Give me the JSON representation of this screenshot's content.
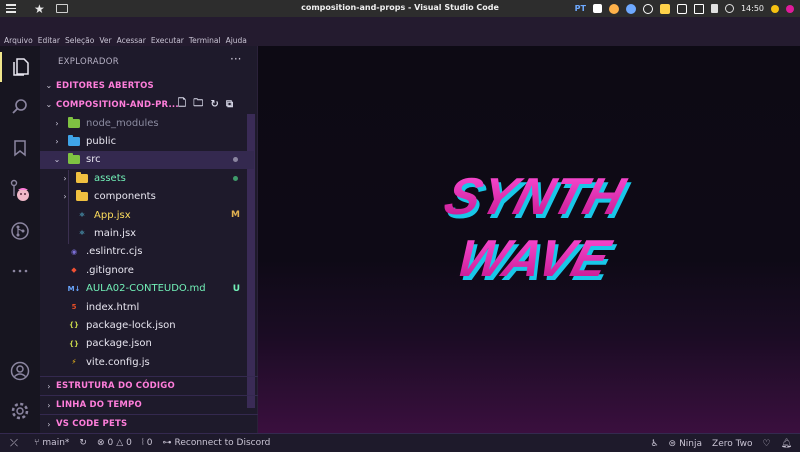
{
  "os": {
    "window_title": "composition-and-props - Visual Studio Code",
    "lang": "PT",
    "clock": "14:50",
    "tray_colors": [
      "#ffffff",
      "#ffb24a",
      "#6ea9ff",
      "#ffffff",
      "#ffd34a",
      "#ffffff"
    ]
  },
  "menu": [
    "Arquivo",
    "Editar",
    "Seleção",
    "Ver",
    "Acessar",
    "Executar",
    "Terminal",
    "Ajuda"
  ],
  "sidebar": {
    "title": "EXPLORADOR",
    "more": "···",
    "sections": {
      "open_editors": "EDITORES ABERTOS",
      "project": "COMPOSITION-AND-PR...",
      "outline": "ESTRUTURA DO CÓDIGO",
      "timeline": "LINHA DO TEMPO",
      "pets": "VS CODE PETS"
    },
    "files": [
      {
        "name": "node_modules",
        "kind": "folder",
        "color": "#8b8ba0",
        "icon_color": "#7fc242"
      },
      {
        "name": "public",
        "kind": "folder",
        "color": "#e8e6f0",
        "icon_color": "#3fa4e8"
      },
      {
        "name": "src",
        "kind": "folder-open",
        "color": "#e8e6f0",
        "icon_color": "#7fc242"
      },
      {
        "name": "assets",
        "kind": "folder",
        "color": "#72f1b8",
        "icon_color": "#f0c040"
      },
      {
        "name": "components",
        "kind": "folder",
        "color": "#e8e6f0",
        "icon_color": "#f0c040"
      },
      {
        "name": "App.jsx",
        "kind": "react",
        "color": "#fede5d",
        "badge": "M"
      },
      {
        "name": "main.jsx",
        "kind": "react",
        "color": "#e8e6f0"
      },
      {
        "name": ".eslintrc.cjs",
        "kind": "eslint",
        "color": "#e8e6f0"
      },
      {
        "name": ".gitignore",
        "kind": "git",
        "color": "#e8e6f0"
      },
      {
        "name": "AULA02-CONTEUDO.md",
        "kind": "md",
        "color": "#72f1b8",
        "badge": "U"
      },
      {
        "name": "index.html",
        "kind": "html",
        "color": "#e8e6f0"
      },
      {
        "name": "package-lock.json",
        "kind": "json",
        "color": "#e8e6f0"
      },
      {
        "name": "package.json",
        "kind": "json",
        "color": "#e8e6f0"
      },
      {
        "name": "vite.config.js",
        "kind": "vite",
        "color": "#e8e6f0"
      }
    ]
  },
  "editor": {
    "logo_line1": "SYNTH",
    "logo_line2": "WAVE"
  },
  "status": {
    "branch": "main*",
    "errors": "0",
    "warnings": "0",
    "ports": "0",
    "discord": "Reconnect to Discord",
    "ninja": "Ninja",
    "theme": "Zero Two"
  }
}
